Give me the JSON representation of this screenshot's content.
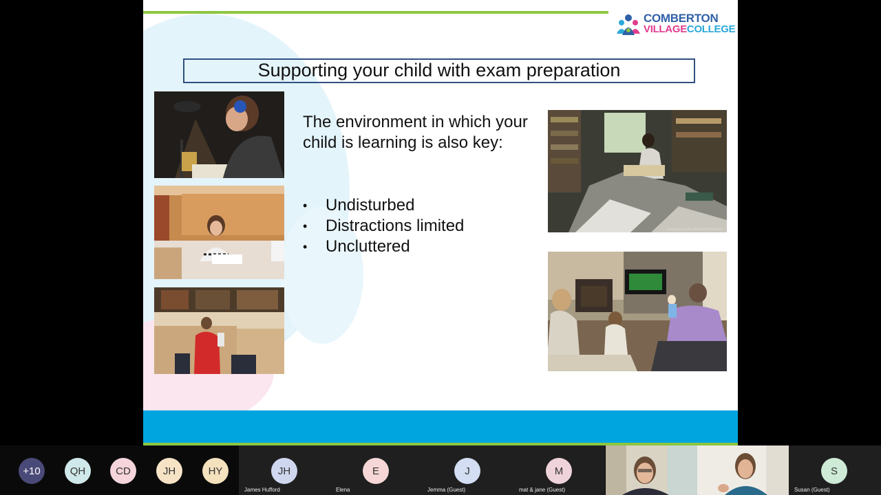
{
  "slide": {
    "logo_line1": "COMBERTON",
    "logo_line2_a": "VILLAGE",
    "logo_line2_b": "COLLEGE",
    "title": "Supporting your child with exam preparation",
    "intro_text": "The environment in which your child is learning is also key:",
    "bullets": [
      "Undisturbed",
      "Distractions limited",
      "Uncluttered"
    ],
    "photo_credit": "Copyright Janine Wiedel Photolibrary",
    "colors": {
      "accent_green": "#8dc63f",
      "accent_blue": "#00a5e0",
      "title_border": "#2f4f7f"
    }
  },
  "participants": {
    "overflow_count": "+10",
    "mini": [
      {
        "initials": "QH",
        "color": "#cfe8ea"
      },
      {
        "initials": "CD",
        "color": "#f6d4dc"
      },
      {
        "initials": "JH",
        "color": "#f6e3c6"
      },
      {
        "initials": "HY",
        "color": "#f4e1bd"
      }
    ],
    "tiles": [
      {
        "initials": "JH",
        "name": "James Hufford",
        "color": "#cfd7ef"
      },
      {
        "initials": "E",
        "name": "Elena",
        "color": "#f6d6d6"
      },
      {
        "initials": "J",
        "name": "Jemma (Guest)",
        "color": "#d3def3"
      },
      {
        "initials": "M",
        "name": "mat & jane (Guest)",
        "color": "#efd3da"
      }
    ],
    "last_tile": {
      "initials": "S",
      "name": "Susan (Guest)",
      "color": "#cdebd6"
    }
  }
}
